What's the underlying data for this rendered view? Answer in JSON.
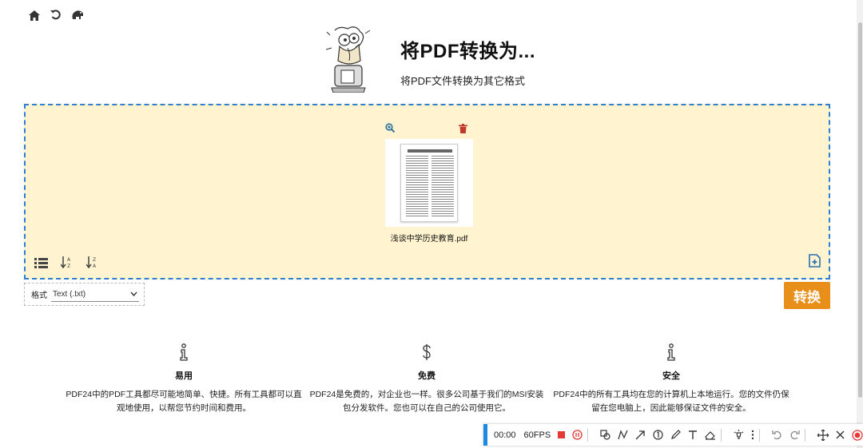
{
  "nav": {
    "icons": [
      "home-icon",
      "undo-icon",
      "elephant-icon"
    ]
  },
  "header": {
    "title": "将PDF转换为...",
    "subtitle": "将PDF文件转换为其它格式"
  },
  "dropzone": {
    "file": {
      "name": "浅谈中学历史教育.pdf"
    },
    "icons": [
      "list-icon",
      "sort-az-icon",
      "sort-za-icon",
      "add-file-icon"
    ]
  },
  "format": {
    "label": "格式",
    "selected": "Text (.txt)"
  },
  "convert": {
    "label": "转换"
  },
  "features": [
    {
      "title": "易用",
      "text": "PDF24中的PDF工具都尽可能地简单、快捷。所有工具都可以直观地使用，以帮您节约时间和费用。"
    },
    {
      "title": "免费",
      "text": "PDF24是免费的，对企业也一样。很多公司基于我们的MSI安装包分发软件。您也可以在自己的公司使用它。"
    },
    {
      "title": "安全",
      "text": "PDF24中的所有工具均在您的计算机上本地运行。您的文件仍保留在您电脑上，因此能够保证文件的安全。"
    }
  ],
  "recorder": {
    "time": "00:00",
    "fps": "60FPS"
  },
  "colors": {
    "accent": "#e88f1a",
    "dropzone_bg": "#fff4cf",
    "dropzone_border": "#2f7fd0",
    "recorder_accent": "#1e88e5"
  }
}
